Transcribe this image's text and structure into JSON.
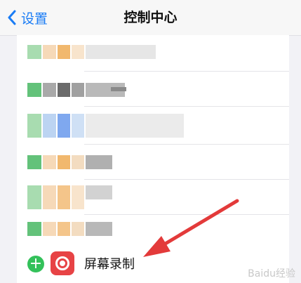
{
  "nav": {
    "back_label": "设置",
    "title": "控制中心"
  },
  "more_controls": {
    "item_label": "屏幕录制"
  },
  "watermark": "Baidu经验",
  "colors": {
    "accent_blue": "#1a7cf5",
    "add_green": "#33c15a",
    "record_red": "#e74345",
    "arrow_red": "#e33a3a"
  }
}
